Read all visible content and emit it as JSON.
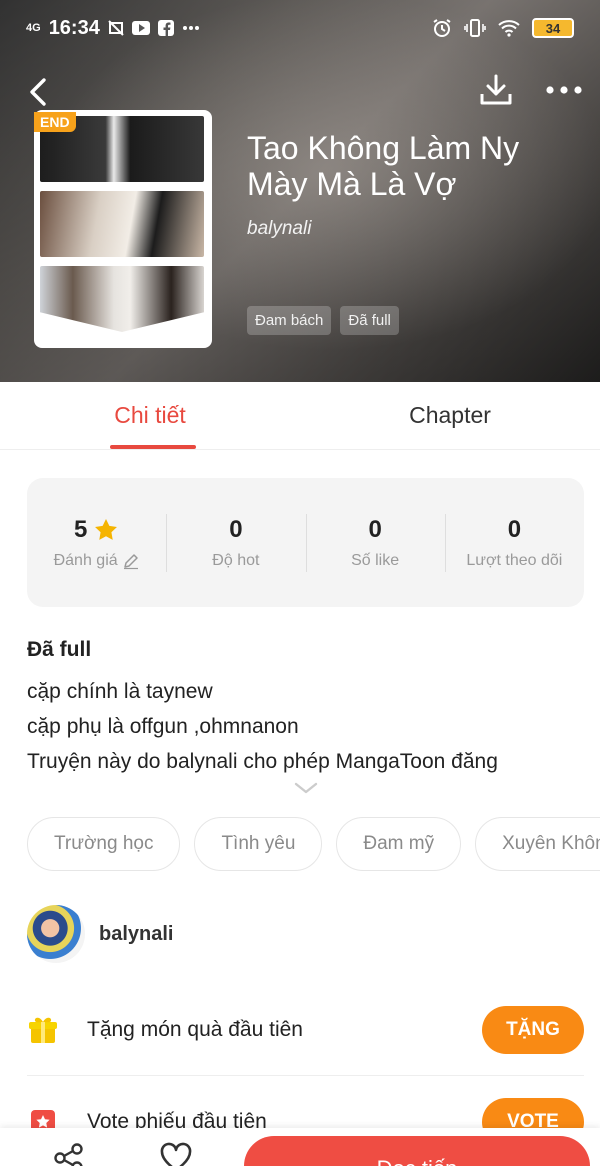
{
  "status_bar": {
    "network": "4G",
    "time": "16:34",
    "battery": "34"
  },
  "manga": {
    "title": "Tao Không Làm Ny Mày Mà Là Vợ",
    "author": "balynali",
    "badge": "END",
    "tags": [
      "Đam bách",
      "Đã full"
    ]
  },
  "tabs": [
    {
      "label": "Chi tiết",
      "active": true
    },
    {
      "label": "Chapter",
      "active": false
    }
  ],
  "stats": [
    {
      "value": "5",
      "label": "Đánh giá"
    },
    {
      "value": "0",
      "label": "Độ hot"
    },
    {
      "value": "0",
      "label": "Số like"
    },
    {
      "value": "0",
      "label": "Lượt theo dõi"
    }
  ],
  "description": {
    "heading": "Đã full",
    "lines": [
      "cặp chính là taynew",
      "cặp phụ là offgun ,ohmnanon",
      "Truyện này do balynali cho phép MangaToon đăng"
    ]
  },
  "genres": [
    "Trường học",
    "Tình yêu",
    "Đam mỹ",
    "Xuyên Không"
  ],
  "author_row": {
    "name": "balynali"
  },
  "actions": [
    {
      "label": "Tặng món quà đầu tiên",
      "button": "TẶNG"
    },
    {
      "label": "Vote phiếu đầu tiên",
      "button": "VOTE"
    }
  ],
  "bottom_bar": {
    "read_label": "Đọc tiếp"
  },
  "colors": {
    "accent_red": "#e8493f",
    "button_orange": "#f98a14",
    "badge_orange": "#f7a21b",
    "star_yellow": "#f5b400"
  }
}
